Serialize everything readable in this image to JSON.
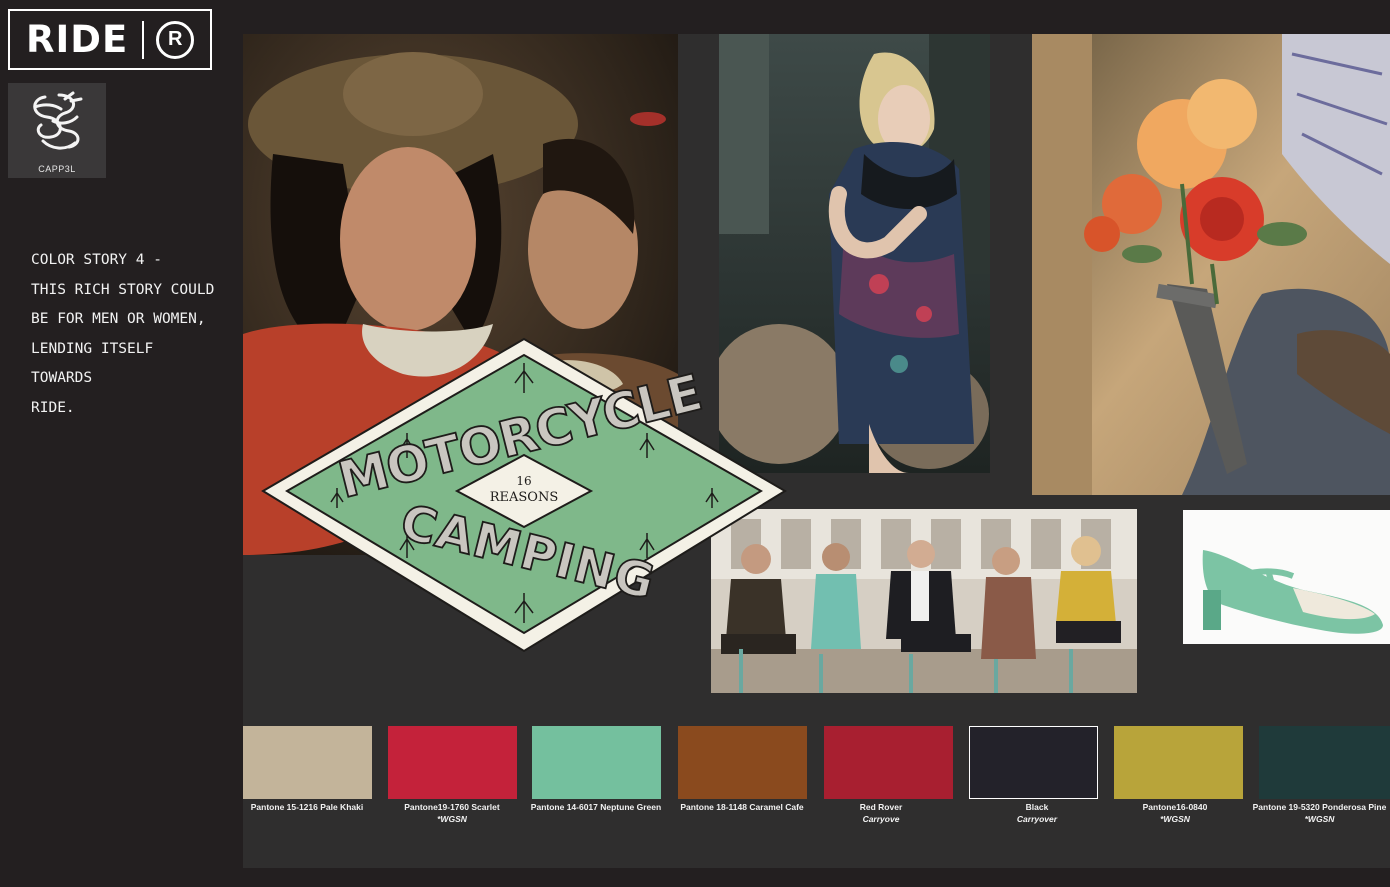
{
  "brand": {
    "ride_wordmark": "RIDE",
    "ride_mark": "R",
    "cappel_name": "CAPP3L"
  },
  "story": {
    "lines": [
      "Color Story  4 -",
      "This rich story could",
      "be for men or women,",
      "lending itself towards",
      "Ride."
    ]
  },
  "badge": {
    "word_top": "MOTORCYCLE",
    "word_bottom": "CAMPING",
    "number": "16",
    "subtitle": "REASONS"
  },
  "swatches": [
    {
      "name": "Pantone 15-1216 Pale Khaki",
      "sub": "",
      "color": "#c3b49a"
    },
    {
      "name": "Pantone19-1760 Scarlet",
      "sub": "*WGSN",
      "color": "#c4223a"
    },
    {
      "name": "Pantone 14-6017 Neptune Green",
      "sub": "",
      "color": "#74c09e"
    },
    {
      "name": "Pantone 18-1148 Caramel Cafe",
      "sub": "",
      "color": "#8a4a1e"
    },
    {
      "name": "Red Rover",
      "sub": "Carryove",
      "color": "#a81f30"
    },
    {
      "name": "Black",
      "sub": "Carryover",
      "color": "#23222a"
    },
    {
      "name": "Pantone16-0840",
      "sub": "*WGSN",
      "color": "#b8a43a"
    },
    {
      "name": "Pantone 19-5320 Ponderosa Pine",
      "sub": "*WGSN",
      "color": "#1f3a3a"
    }
  ]
}
